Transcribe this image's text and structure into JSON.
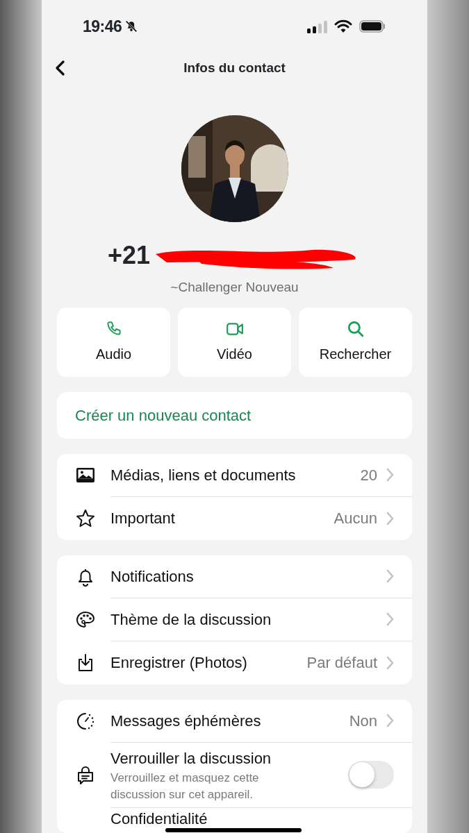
{
  "status_bar": {
    "time": "19:46",
    "silent": true
  },
  "header": {
    "title": "Infos du contact"
  },
  "profile": {
    "phone": "+21",
    "redacted": true,
    "name": "~Challenger Nouveau"
  },
  "actions": [
    {
      "kind": "audio",
      "label": "Audio"
    },
    {
      "kind": "video",
      "label": "Vidéo"
    },
    {
      "kind": "search",
      "label": "Rechercher"
    }
  ],
  "create_contact": {
    "label": "Créer un nouveau contact"
  },
  "groups": [
    [
      {
        "kind": "media",
        "label": "Médias, liens et documents",
        "value": "20"
      },
      {
        "kind": "star",
        "label": "Important",
        "value": "Aucun"
      }
    ],
    [
      {
        "kind": "bell",
        "label": "Notifications"
      },
      {
        "kind": "palette",
        "label": "Thème de la discussion"
      },
      {
        "kind": "save",
        "label": "Enregistrer (Photos)",
        "value": "Par défaut"
      }
    ],
    [
      {
        "kind": "timer",
        "label": "Messages éphémères",
        "value": "Non"
      },
      {
        "kind": "lock",
        "label": "Verrouiller la discussion",
        "description": "Verrouillez et masquez cette discussion sur cet appareil.",
        "on": false
      },
      {
        "kind": "plain",
        "label": "Confidentialité"
      }
    ]
  ]
}
